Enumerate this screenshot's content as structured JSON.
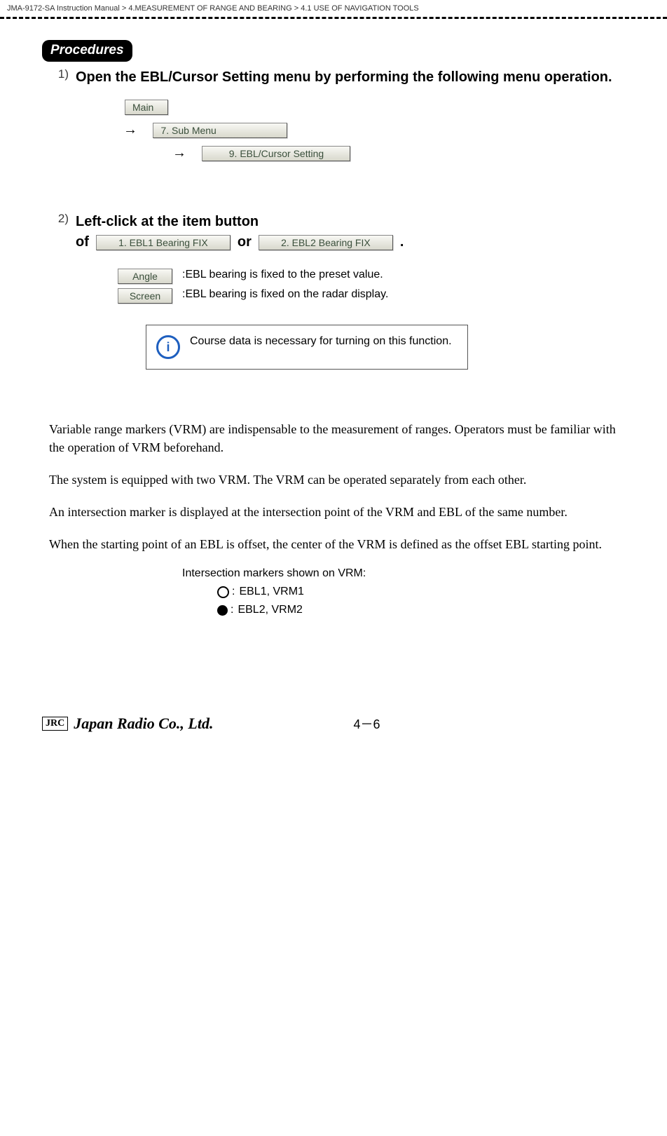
{
  "breadcrumb": {
    "doc": "JMA-9172-SA Instruction Manual",
    "sep": ">",
    "ch": "4.MEASUREMENT OF RANGE AND BEARING",
    "sec": "4.1  USE OF NAVIGATION TOOLS"
  },
  "procedures_label": "Procedures",
  "steps": {
    "s1": {
      "num": "1)",
      "heading": "Open the EBL/Cursor Setting menu by performing the following menu operation.",
      "menu": {
        "main": "Main",
        "sub": "7. Sub Menu",
        "ebl": "9. EBL/Cursor Setting",
        "arrow": "→"
      }
    },
    "s2": {
      "num": "2)",
      "heading": "Left-click at the item button",
      "of": "of ",
      "or": " or ",
      "dot": " .",
      "btn1": "1. EBL1 Bearing FIX",
      "btn2": "2. EBL2 Bearing FIX",
      "opt_angle_label": "Angle",
      "opt_angle_text": ":EBL bearing is fixed to the preset value.",
      "opt_screen_label": "Screen",
      "opt_screen_text": ":EBL bearing is fixed on the radar display."
    }
  },
  "note": {
    "icon": "i",
    "text": "Course data is necessary for turning on this function."
  },
  "body": {
    "p1": "Variable range markers (VRM) are indispensable to the measurement of ranges. Operators must be familiar with the operation of VRM beforehand.",
    "p2": "The system is equipped with two VRM. The VRM can be operated separately from each other.",
    "p3": "An intersection marker is displayed at the intersection point of the VRM and EBL of the same number.",
    "p4": "When the starting point of an EBL is offset, the center of the VRM is defined as the offset EBL starting point."
  },
  "markers": {
    "title": "Intersection markers shown on VRM:",
    "m1": "EBL1, VRM1",
    "m2": "EBL2, VRM2",
    "colon": ":"
  },
  "footer": {
    "logo": "JRC",
    "brand": "Japan Radio Co., Ltd.",
    "page": "4－6"
  }
}
